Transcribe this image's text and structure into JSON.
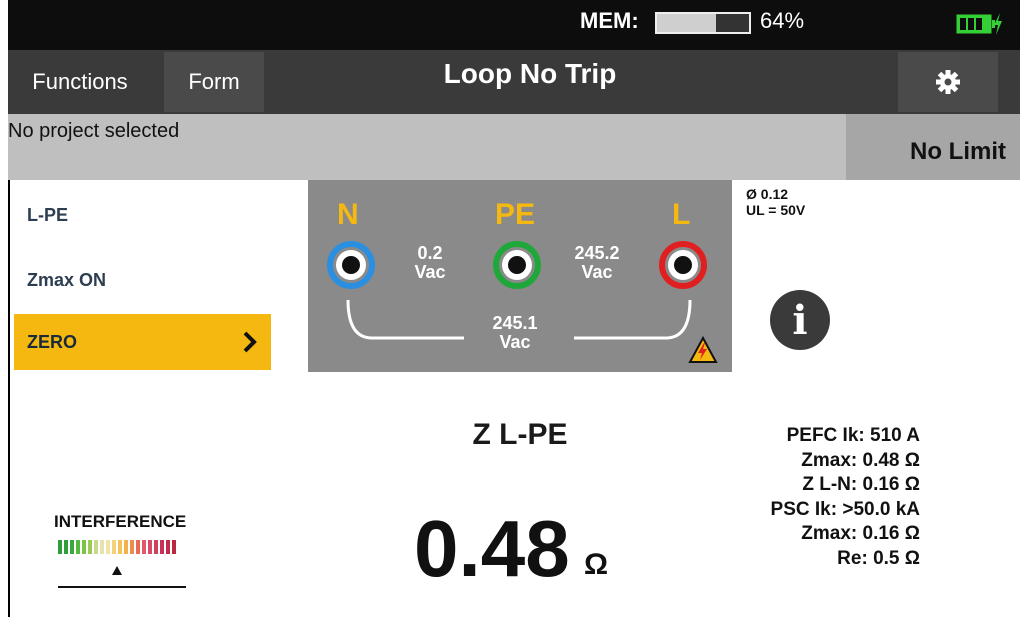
{
  "status": {
    "mem_label": "MEM:",
    "mem_percent": "64%",
    "mem_fill_fraction": 0.64,
    "battery_icon": "battery-charging-icon"
  },
  "header": {
    "functions_label": "Functions",
    "form_label": "Form",
    "title": "Loop No Trip",
    "settings_icon": "gear-icon"
  },
  "project": {
    "text": "No project selected",
    "limit": "No Limit"
  },
  "menu": {
    "items": [
      {
        "label": "L-PE"
      },
      {
        "label": "Zmax ON"
      },
      {
        "label": "ZERO"
      }
    ]
  },
  "terminals": {
    "n_label": "N",
    "pe_label": "PE",
    "l_label": "L",
    "v_npe_value": "0.2",
    "v_npe_unit": "Vac",
    "v_pel_value": "245.2",
    "v_pel_unit": "Vac",
    "v_nl_value": "245.1",
    "v_nl_unit": "Vac",
    "colors": {
      "n": "#2a8fe0",
      "pe": "#1fa83a",
      "l": "#e02020"
    }
  },
  "settings_info": {
    "phase": "Ø 0.12",
    "ul": "UL = 50V"
  },
  "measurement": {
    "label": "Z L-PE",
    "value": "0.48",
    "unit": "Ω"
  },
  "results": [
    "PEFC Ik: 510 A",
    "Zmax: 0.48 Ω",
    "Z L-N: 0.16 Ω",
    "PSC Ik: >50.0 kA",
    "Zmax: 0.16 Ω",
    "Re: 0.5 Ω"
  ],
  "interference": {
    "label": "INTERFERENCE",
    "level_fraction": 0.5
  },
  "colors": {
    "accent": "#f5b810",
    "dark": "#3a3a3a"
  }
}
